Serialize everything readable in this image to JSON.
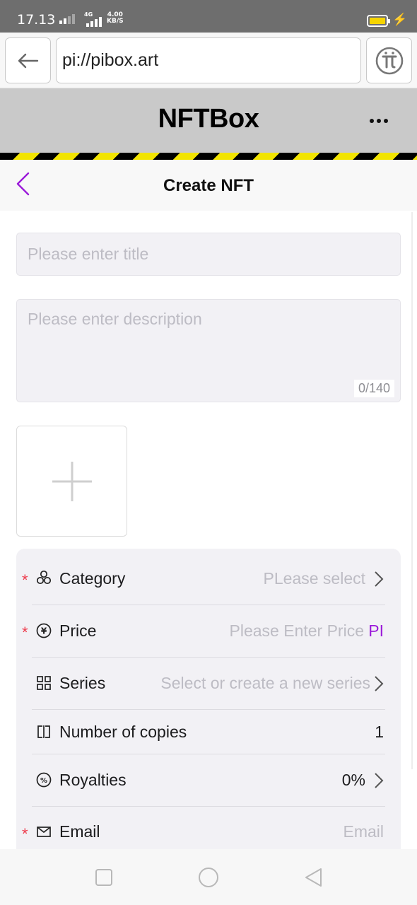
{
  "status_bar": {
    "time": "17.13",
    "network": "4G",
    "speed_value": "4.00",
    "speed_unit": "KB/S",
    "battery_color": "#f5d400"
  },
  "browser": {
    "url": "pi://pibox.art",
    "back_icon": "arrow-left-icon",
    "pi_icon": "pi-logo-icon"
  },
  "app": {
    "title": "NFTBox",
    "menu_icon": "more-dots-icon"
  },
  "page": {
    "title": "Create NFT",
    "back_icon": "chevron-left-icon",
    "accent_color": "#9b1ad9"
  },
  "form": {
    "title_placeholder": "Please enter title",
    "description_placeholder": "Please enter description",
    "description_counter": "0/140",
    "upload_icon": "plus-icon",
    "rows": [
      {
        "label": "Category",
        "required": true,
        "icon": "category-icon",
        "value": "PLease select"
      },
      {
        "label": "Price",
        "required": true,
        "icon": "yen-coin-icon",
        "value": "Please Enter Price",
        "unit": "PI"
      },
      {
        "label": "Series",
        "required": false,
        "icon": "grid-icon",
        "value": "Select or create a new series"
      },
      {
        "label": "Number of copies",
        "required": false,
        "icon": "copies-icon",
        "value": "1"
      },
      {
        "label": "Royalties",
        "required": false,
        "icon": "percent-icon",
        "value": "0%"
      },
      {
        "label": "Email",
        "required": true,
        "icon": "email-icon",
        "value": "Email"
      }
    ],
    "required_mark": "*"
  },
  "nav_bar": {
    "items": [
      "square-icon",
      "circle-icon",
      "triangle-back-icon"
    ]
  }
}
